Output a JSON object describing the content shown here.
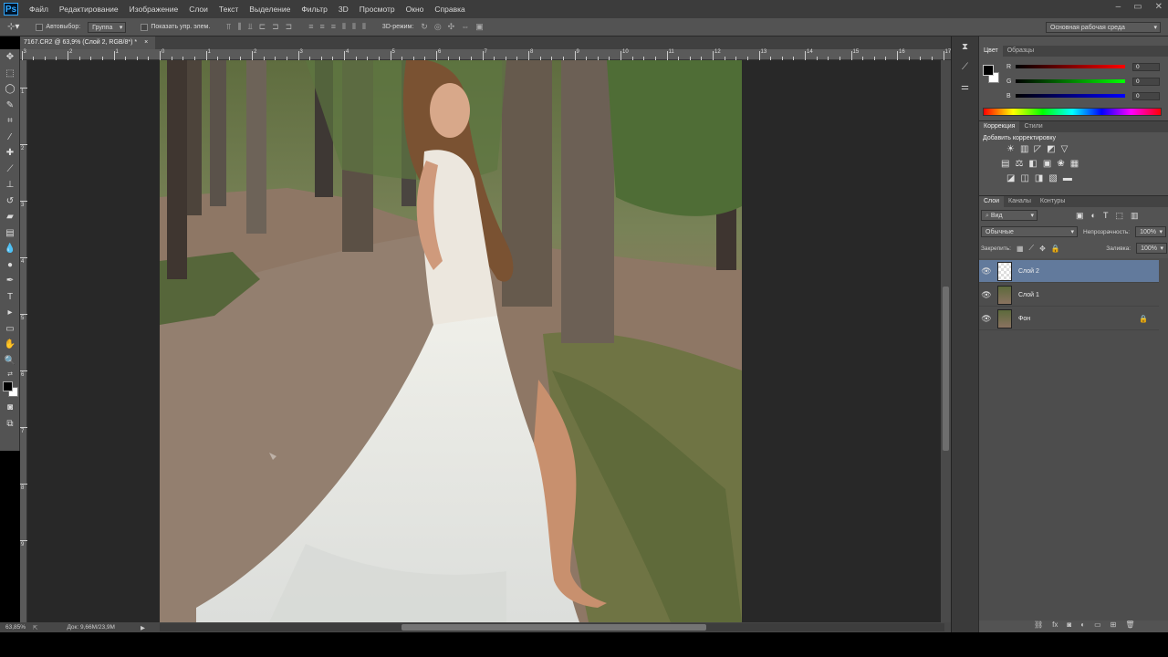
{
  "menubar": {
    "logo": "Ps",
    "items": [
      "Файл",
      "Редактирование",
      "Изображение",
      "Слои",
      "Текст",
      "Выделение",
      "Фильтр",
      "3D",
      "Просмотр",
      "Окно",
      "Справка"
    ],
    "controls": [
      "–",
      "▭",
      "✕"
    ]
  },
  "options": {
    "autoselect_label": "Автовыбор:",
    "autoselect_value": "Группа",
    "show_controls_label": "Показать упр. элем.",
    "mode3d_label": "3D-режим:",
    "workspace_value": "Основная рабочая среда"
  },
  "document": {
    "tab_title": "7167.CR2 @ 63,9% (Слой 2, RGB/8*) *",
    "tab_close": "×"
  },
  "rulers": {
    "top": [
      "3",
      "2",
      "1",
      "0",
      "1",
      "2",
      "3",
      "4",
      "5",
      "6",
      "7",
      "8",
      "9",
      "10",
      "11",
      "12",
      "13",
      "14",
      "15",
      "16",
      "17"
    ],
    "left": [
      "1",
      "2",
      "3",
      "4",
      "5",
      "6",
      "7",
      "8",
      "9"
    ]
  },
  "status": {
    "zoom": "63,85%",
    "doc_info": "Док: 9,66M/23,9M",
    "arrow": "▶"
  },
  "color_panel": {
    "tabs": [
      "Цвет",
      "Образцы"
    ],
    "channels": [
      {
        "label": "R",
        "value": "0"
      },
      {
        "label": "G",
        "value": "0"
      },
      {
        "label": "B",
        "value": "0"
      }
    ]
  },
  "adjustments_panel": {
    "tabs": [
      "Коррекция",
      "Стили"
    ],
    "title": "Добавить корректировку"
  },
  "layers_panel": {
    "tabs": [
      "Слои",
      "Каналы",
      "Контуры"
    ],
    "filter_value": "Вид",
    "blend_mode": "Обычные",
    "opacity_label": "Непрозрачность:",
    "opacity_value": "100%",
    "lock_label": "Закрепить:",
    "fill_label": "Заливка:",
    "fill_value": "100%",
    "layers": [
      {
        "name": "Слой 2",
        "selected": true,
        "locked": false
      },
      {
        "name": "Слой 1",
        "selected": false,
        "locked": false
      },
      {
        "name": "Фон",
        "selected": false,
        "locked": true
      }
    ]
  }
}
